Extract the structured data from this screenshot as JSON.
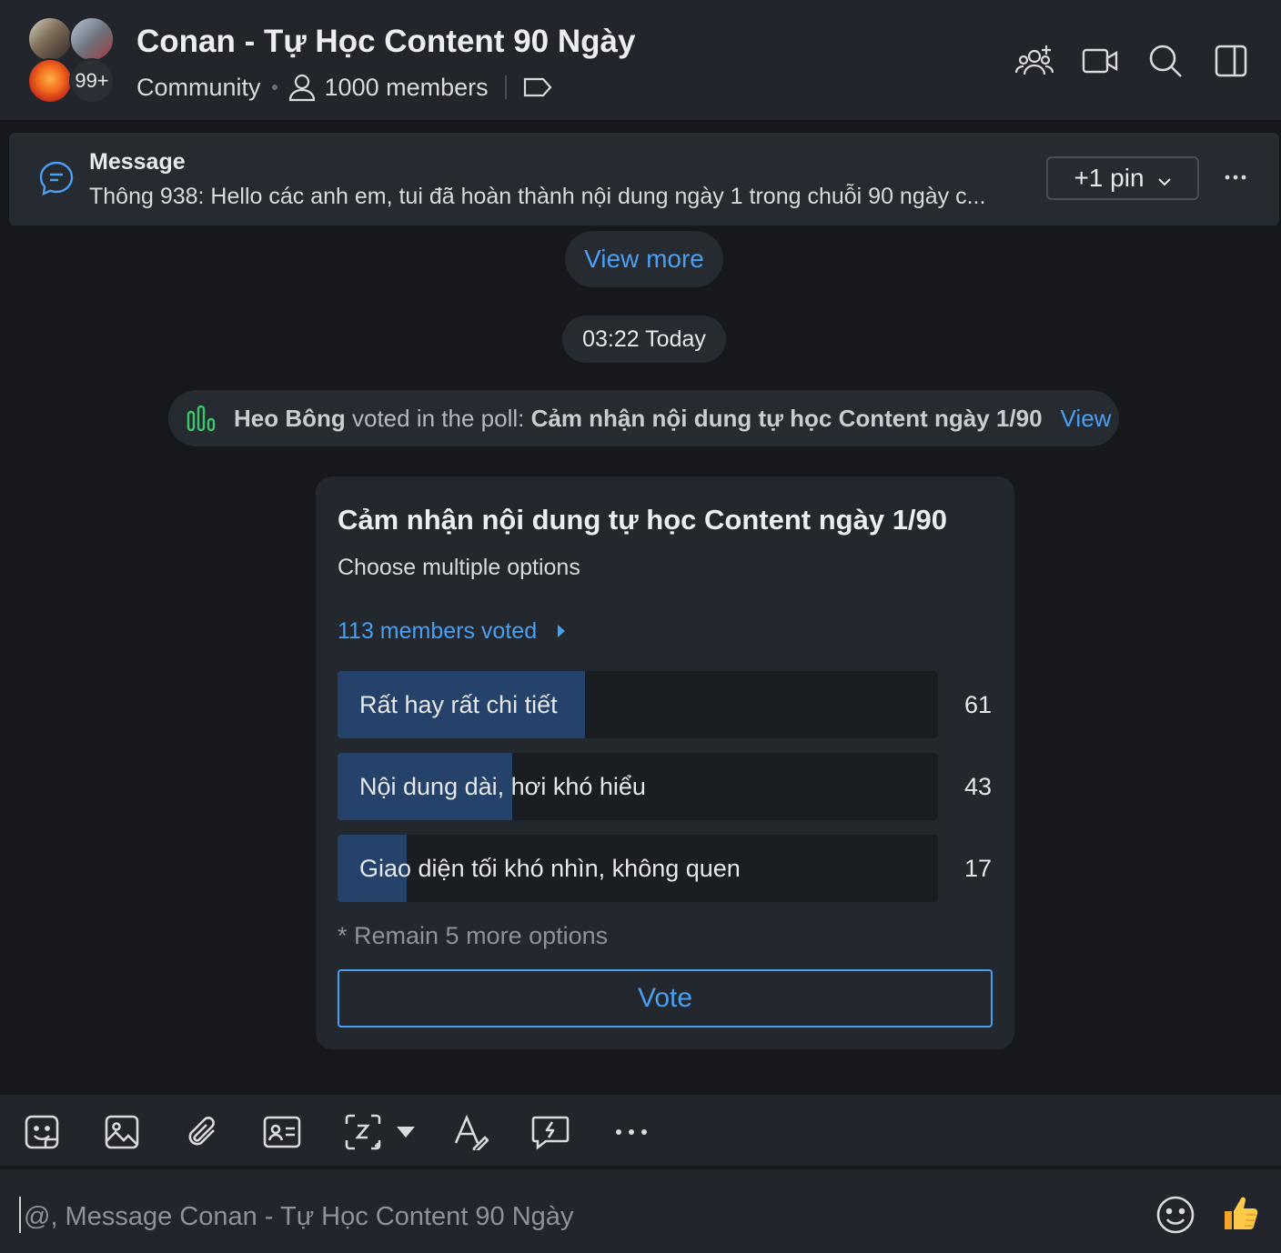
{
  "header": {
    "title": "Conan - Tự Học Content 90 Ngày",
    "type_label": "Community",
    "members_label": "1000 members",
    "avatar_more_badge": "99+"
  },
  "header_icons": [
    "add-member-icon",
    "video-call-icon",
    "search-icon",
    "sidebar-toggle-icon"
  ],
  "pinned": {
    "label": "Message",
    "text": "Thông 938: Hello các anh em, tui đã hoàn thành nội dung ngày 1 trong chuỗi 90 ngày c...",
    "pin_button": "+1 pin"
  },
  "view_more": "View more",
  "time_chip": "03:22 Today",
  "notice": {
    "user": "Heo Bông",
    "action": " voted in the poll: ",
    "poll_name": "Cảm nhận nội dung tự học Content ngày 1/90",
    "link": "View"
  },
  "poll": {
    "title": "Cảm nhận nội dung tự học Content ngày 1/90",
    "subtitle": "Choose multiple options",
    "voted_label": "113 members voted",
    "options": [
      {
        "label": "Rất hay rất chi tiết",
        "count": "61",
        "fraction": 0.412
      },
      {
        "label": "Nội dung dài, hơi khó hiểu",
        "count": "43",
        "fraction": 0.291
      },
      {
        "label": "Giao diện tối khó nhìn, không quen",
        "count": "17",
        "fraction": 0.115
      }
    ],
    "remain": "* Remain 5 more options",
    "vote_button": "Vote"
  },
  "toolbar_icons": [
    "sticker-icon",
    "image-icon",
    "attachment-icon",
    "contact-card-icon",
    "screenshot-icon",
    "dropdown-caret-icon",
    "text-format-icon",
    "quick-message-icon",
    "more-options-icon"
  ],
  "composer": {
    "placeholder": "@, Message Conan - Tự Học Content 90 Ngày"
  },
  "colors": {
    "accent": "#4a9ff2",
    "poll_fill": "#25436a",
    "background": "#16181c",
    "panel": "#22252b"
  }
}
